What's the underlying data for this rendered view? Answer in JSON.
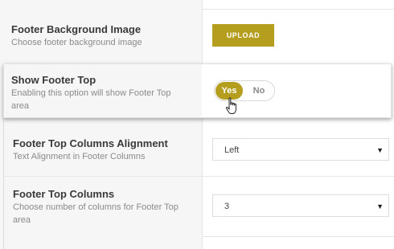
{
  "settings": {
    "footer_bg_image": {
      "title": "Footer Background Image",
      "description": "Choose footer background image",
      "button_label": "UPLOAD"
    },
    "show_footer_top": {
      "title": "Show Footer Top",
      "description_line1": "Enabling this option will show Footer Top",
      "description_line2": "area",
      "toggle_on_label": "Yes",
      "toggle_off_label": "No",
      "value": "Yes"
    },
    "footer_top_columns_alignment": {
      "title": "Footer Top Columns Alignment",
      "description": "Text Alignment in Footer Columns",
      "selected": "Left"
    },
    "footer_top_columns": {
      "title": "Footer Top Columns",
      "description_line1": "Choose number of columns for Footer Top",
      "description_line2": "area",
      "selected": "3"
    }
  },
  "colors": {
    "accent": "#b59d1e",
    "panel_background": "#f6f6f6"
  },
  "icons": {
    "cursor": "hand-pointer-icon",
    "dropdown": "triangle-down-icon"
  }
}
